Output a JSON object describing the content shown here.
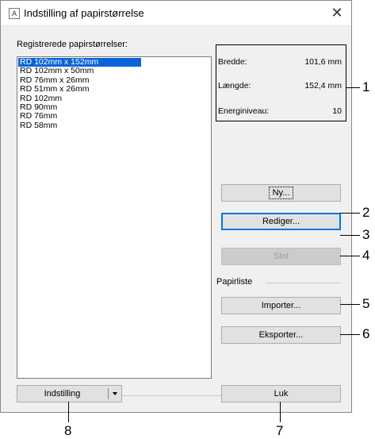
{
  "window": {
    "title": "Indstilling af papirstørrelse",
    "app_icon_glyph": "A",
    "close_glyph": "✕"
  },
  "list": {
    "label": "Registrerede papirstørrelser:",
    "items": [
      "RD 102mm x 152mm",
      "RD 102mm x 50mm",
      "RD 76mm x 26mm",
      "RD 51mm x 26mm",
      "RD 102mm",
      "RD 90mm",
      "RD 76mm",
      "RD 58mm"
    ],
    "selected_index": 0
  },
  "info": {
    "width_label": "Bredde:",
    "width_value": "101,6 mm",
    "length_label": "Længde:",
    "length_value": "152,4 mm",
    "energy_label": "Energiniveau:",
    "energy_value": "10"
  },
  "buttons": {
    "new": "Ny...",
    "edit": "Rediger...",
    "delete": "Slet",
    "import": "Importer...",
    "export": "Eksporter...",
    "setting": "Indstilling",
    "close": "Luk"
  },
  "paper_list_label": "Papirliste",
  "callouts": [
    "1",
    "2",
    "3",
    "4",
    "5",
    "6",
    "7",
    "8"
  ],
  "colors": {
    "selection": "#0a64d8",
    "focus_border": "#0078d7",
    "dialog_bg": "#f0f0f0"
  }
}
